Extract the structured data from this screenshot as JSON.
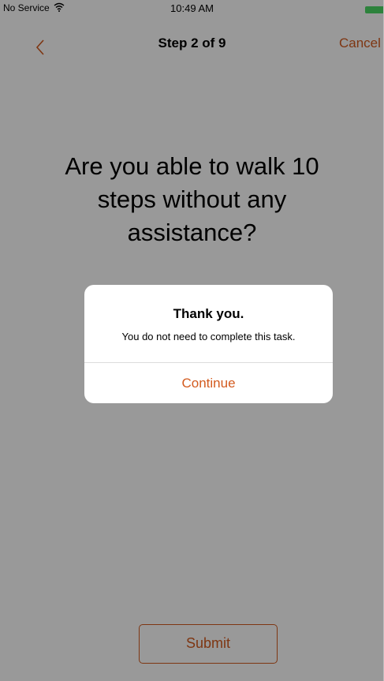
{
  "status_bar": {
    "carrier": "No Service",
    "time": "10:49 AM",
    "battery_color": "#4cd964"
  },
  "nav": {
    "title": "Step 2 of 9",
    "cancel_label": "Cancel",
    "back_icon": "chevron-left-icon",
    "accent_color": "#d35b1f"
  },
  "question": {
    "text": "Are you able to walk 10 steps without any assistance?"
  },
  "alert": {
    "title": "Thank you.",
    "message": "You do not need to complete this task.",
    "button_label": "Continue"
  },
  "footer": {
    "submit_label": "Submit"
  }
}
